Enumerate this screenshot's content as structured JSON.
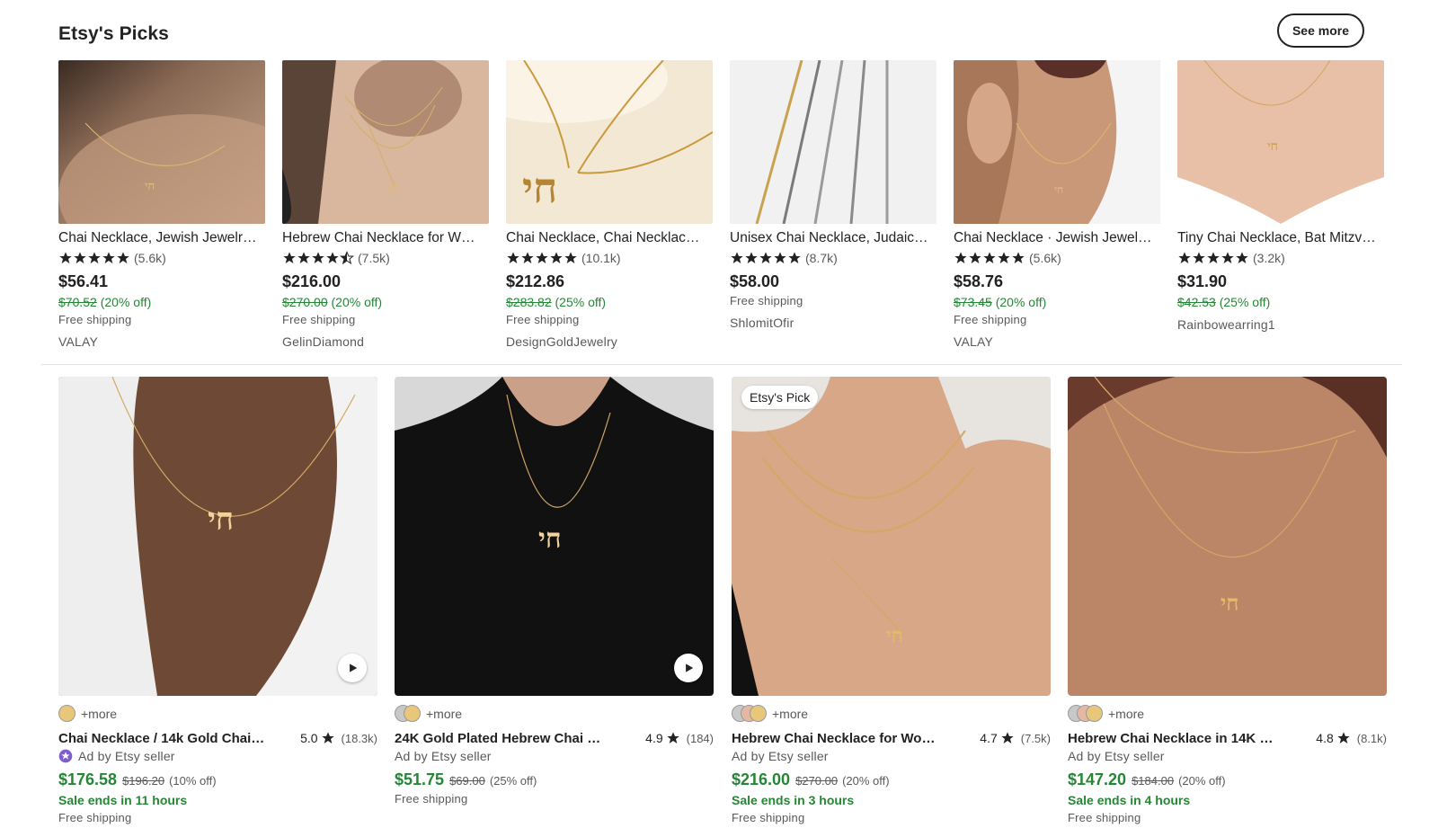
{
  "section": {
    "title": "Etsy's Picks",
    "see_more": "See more"
  },
  "picks": [
    {
      "title": "Chai Necklace, Jewish Jewelr…",
      "rating": "(5.6k)",
      "price": "$56.41",
      "orig": "$70.52",
      "off": "(20% off)",
      "ship": "Free shipping",
      "shop": "VALAY"
    },
    {
      "title": "Hebrew Chai Necklace for W…",
      "rating": "(7.5k)",
      "price": "$216.00",
      "orig": "$270.00",
      "off": "(20% off)",
      "ship": "Free shipping",
      "shop": "GelinDiamond"
    },
    {
      "title": "Chai Necklace, Chai Necklac…",
      "rating": "(10.1k)",
      "price": "$212.86",
      "orig": "$283.82",
      "off": "(25% off)",
      "ship": "Free shipping",
      "shop": "DesignGoldJewelry"
    },
    {
      "title": "Unisex Chai Necklace, Judaic…",
      "rating": "(8.7k)",
      "price": "$58.00",
      "ship": "Free shipping",
      "shop": "ShlomitOfir"
    },
    {
      "title": "Chai Necklace · Jewish Jewel…",
      "rating": "(5.6k)",
      "price": "$58.76",
      "orig": "$73.45",
      "off": "(20% off)",
      "ship": "Free shipping",
      "shop": "VALAY"
    },
    {
      "title": "Tiny Chai Necklace, Bat Mitzv…",
      "rating": "(3.2k)",
      "price": "$31.90",
      "orig": "$42.53",
      "off": "(25% off)",
      "shop": "Rainbowearring1"
    }
  ],
  "cards": [
    {
      "title": "Chai Necklace / 14k Gold Chai C…",
      "score": "5.0",
      "count": "(18.3k)",
      "more": "+more",
      "ad": "Ad by Etsy seller",
      "price": "$176.58",
      "orig": "$196.20",
      "off": "(10% off)",
      "sale": "Sale ends in 11 hours",
      "ship": "Free shipping"
    },
    {
      "title": "24K Gold Plated Hebrew Chai N…",
      "score": "4.9",
      "count": "(184)",
      "more": "+more",
      "ad": "Ad by Etsy seller",
      "price": "$51.75",
      "orig": "$69.00",
      "off": "(25% off)",
      "ship": "Free shipping"
    },
    {
      "title": "Hebrew Chai Necklace for Wom…",
      "score": "4.7",
      "count": "(7.5k)",
      "more": "+more",
      "ad": "Ad by Etsy seller",
      "price": "$216.00",
      "orig": "$270.00",
      "off": "(20% off)",
      "sale": "Sale ends in 3 hours",
      "ship": "Free shipping",
      "badge": "Etsy's Pick"
    },
    {
      "title": "Hebrew Chai Necklace in 14K So…",
      "score": "4.8",
      "count": "(8.1k)",
      "more": "+more",
      "ad": "Ad by Etsy seller",
      "price": "$147.20",
      "orig": "$184.00",
      "off": "(20% off)",
      "sale": "Sale ends in 4 hours",
      "ship": "Free shipping"
    }
  ],
  "colors": {
    "sale_green": "#258635",
    "star": "#222222",
    "swatch_gold": "#e8c77a",
    "swatch_silver": "#c8c8c8",
    "swatch_rose": "#e6b8a2"
  }
}
